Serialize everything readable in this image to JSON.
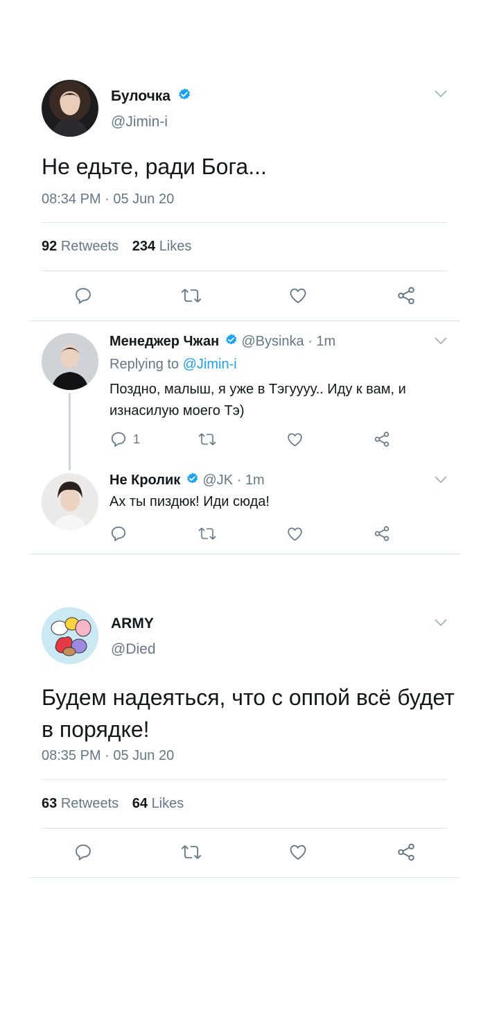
{
  "tweet1": {
    "name": "Булочка",
    "handle": "@Jimin-i",
    "text": "Не едьте, ради Бога...",
    "timestamp": "08:34 PM · 05 Jun 20",
    "retweets_count": "92",
    "retweets_label": "Retweets",
    "likes_count": "234",
    "likes_label": "Likes"
  },
  "reply1": {
    "name": "Менеджер Чжан",
    "handle": "@Bysinka",
    "time": "· 1m",
    "replying_prefix": "Replying to",
    "replying_to": "@Jimin-i",
    "text": "Поздно, малыш, я уже в Тэгуууу.. Иду к вам, и изнасилую моего Тэ)",
    "reply_count": "1"
  },
  "reply2": {
    "name": "Не Кролик",
    "handle": "@JK",
    "time": "· 1m",
    "text": "Ах ты пиздюк! Иди сюда!"
  },
  "tweet2": {
    "name": "ARMY",
    "handle": "@Died",
    "text": "Будем надеяться, что с оппой всё будет в порядке!",
    "timestamp": "08:35 PM · 05 Jun 20",
    "retweets_count": "63",
    "retweets_label": "Retweets",
    "likes_count": "64",
    "likes_label": "Likes"
  },
  "colors": {
    "verified": "#1da1f2",
    "link": "#1da1f2",
    "icon": "#657786",
    "separator": "#e1e8ed"
  }
}
